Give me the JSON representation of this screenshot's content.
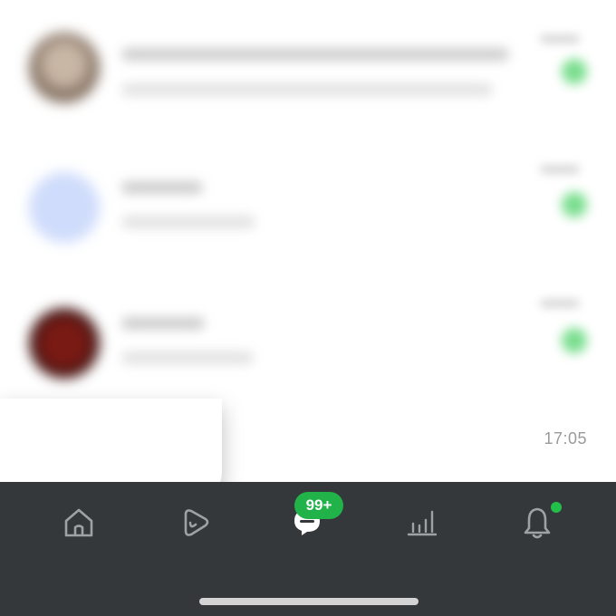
{
  "chat_list": {
    "visible_timestamp": "17:05"
  },
  "bottom_nav": {
    "items": [
      {
        "icon": "home-icon"
      },
      {
        "icon": "play-icon"
      },
      {
        "icon": "chat-bubble-icon",
        "badge": "99+"
      },
      {
        "icon": "bar-chart-icon"
      },
      {
        "icon": "bell-icon",
        "has_dot": true
      }
    ]
  },
  "colors": {
    "nav_background": "#35383b",
    "badge_green": "#21b24a",
    "unread_green": "#3fcf5c",
    "icon_gray": "#9ea2a5"
  }
}
